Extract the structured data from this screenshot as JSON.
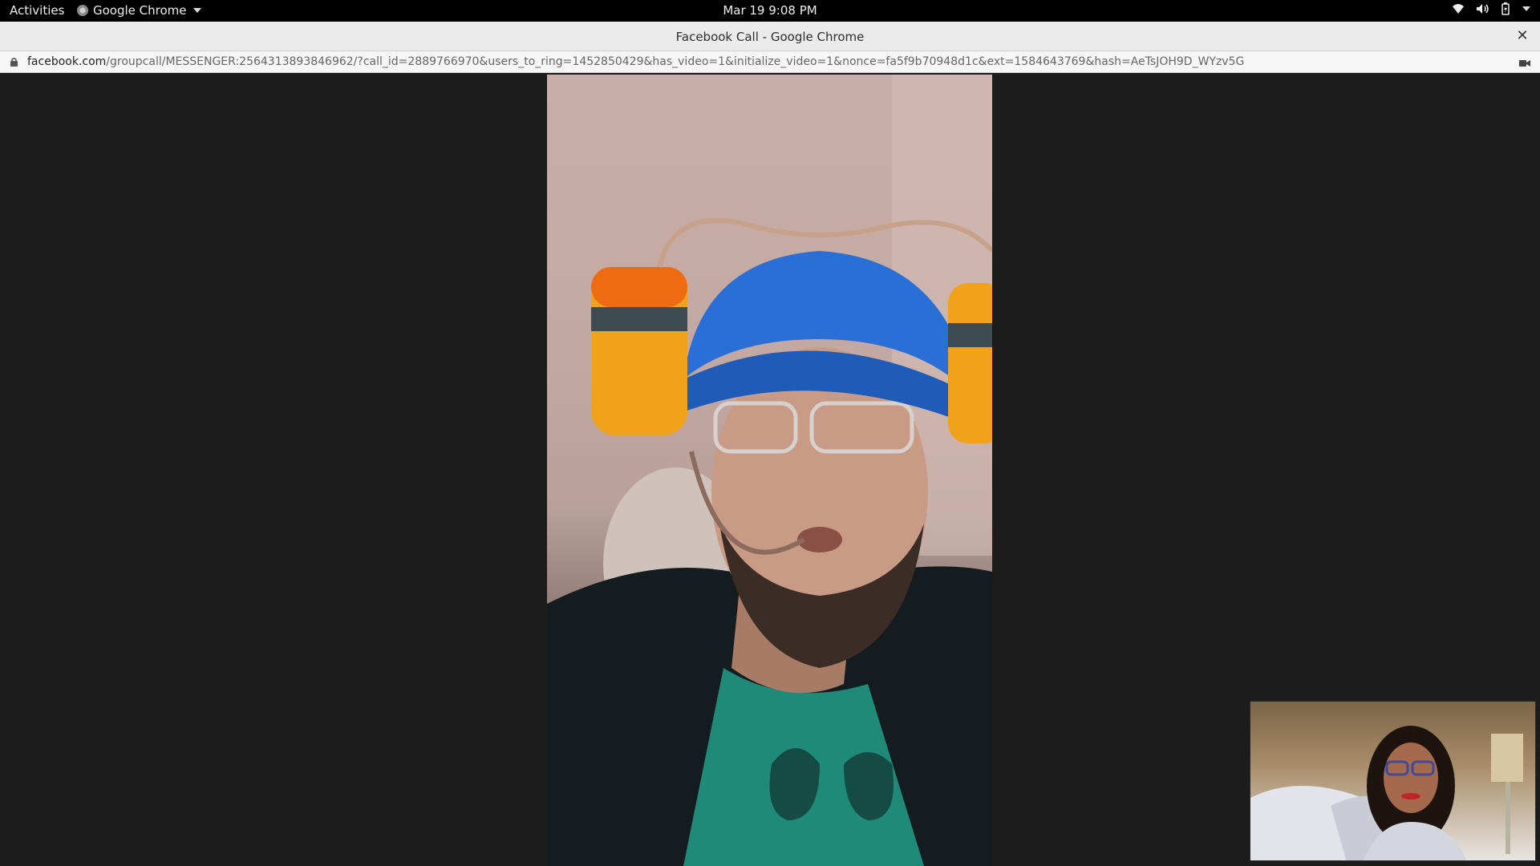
{
  "topbar": {
    "activities": "Activities",
    "app_name": "Google Chrome",
    "clock": "Mar 19  9:08 PM",
    "icons": [
      "wifi-icon",
      "volume-icon",
      "battery-icon",
      "system-menu-caret-icon"
    ]
  },
  "window": {
    "title": "Facebook Call - Google Chrome",
    "close_icon": "close-icon"
  },
  "urlbar": {
    "host": "facebook.com",
    "path": "/groupcall/MESSENGER:2564313893846962/?call_id=2889766970&users_to_ring=1452850429&has_video=1&initialize_video=1&nonce=fa5f9b70948d1c&ext=1584643769&hash=AeTsJOH9D_WYzv5G",
    "lock_icon": "lock-icon",
    "camera_icon": "camera-icon"
  },
  "call": {
    "remote_video": "remote-participant-video",
    "self_view": "self-view-video"
  },
  "colors": {
    "background": "#1c1c1c",
    "topbar": "#000000",
    "titlebar": "#ebebeb"
  }
}
